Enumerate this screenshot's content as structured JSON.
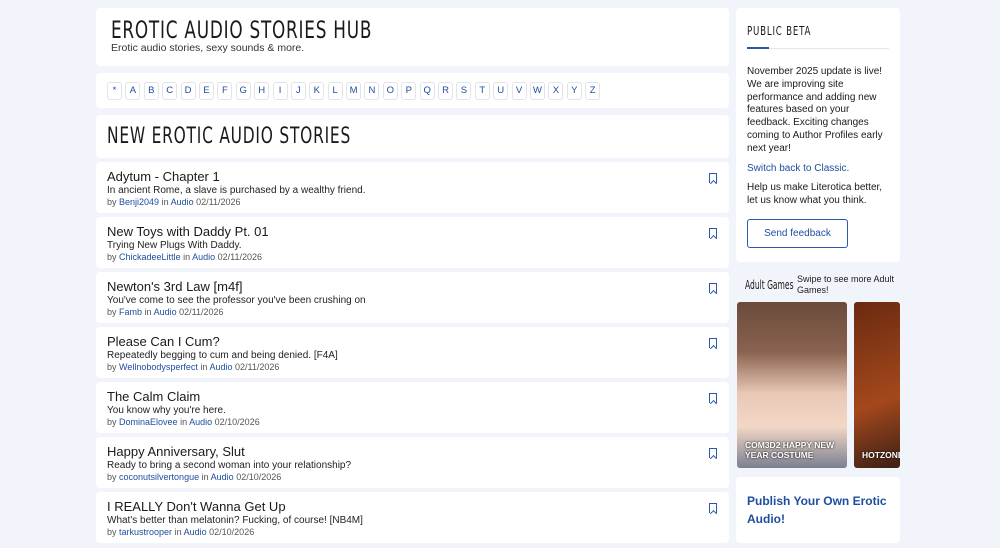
{
  "header": {
    "title": "EROTIC AUDIO STORIES HUB",
    "subtitle": "Erotic audio stories, sexy sounds & more."
  },
  "alphabet": [
    "*",
    "A",
    "B",
    "C",
    "D",
    "E",
    "F",
    "G",
    "H",
    "I",
    "J",
    "K",
    "L",
    "M",
    "N",
    "O",
    "P",
    "Q",
    "R",
    "S",
    "T",
    "U",
    "V",
    "W",
    "X",
    "Y",
    "Z"
  ],
  "section_title": "NEW EROTIC AUDIO STORIES",
  "stories": [
    {
      "title": "Adytum - Chapter 1",
      "desc": "In ancient Rome, a slave is purchased by a wealthy friend.",
      "author": "Benji2049",
      "category": "Audio",
      "date": "02/11/2026"
    },
    {
      "title": "New Toys with Daddy Pt. 01",
      "desc": "Trying New Plugs With Daddy.",
      "author": "ChickadeeLittle",
      "category": "Audio",
      "date": "02/11/2026"
    },
    {
      "title": "Newton's 3rd Law [m4f]",
      "desc": "You've come to see the professor you've been crushing on",
      "author": "Famb",
      "category": "Audio",
      "date": "02/11/2026"
    },
    {
      "title": "Please Can I Cum?",
      "desc": "Repeatedly begging to cum and being denied. [F4A]",
      "author": "Wellnobodysperfect",
      "category": "Audio",
      "date": "02/11/2026"
    },
    {
      "title": "The Calm Claim",
      "desc": "You know why you're here.",
      "author": "DominaElovee",
      "category": "Audio",
      "date": "02/10/2026"
    },
    {
      "title": "Happy Anniversary, Slut",
      "desc": "Ready to bring a second woman into your relationship?",
      "author": "coconutsilvertongue",
      "category": "Audio",
      "date": "02/10/2026"
    },
    {
      "title": "I REALLY Don't Wanna Get Up",
      "desc": "What's better than melatonin? Fucking, of course! [NB4M]",
      "author": "tarkustrooper",
      "category": "Audio",
      "date": "02/10/2026"
    }
  ],
  "labels": {
    "by": "by",
    "in": "in"
  },
  "sidebar": {
    "title": "PUBLIC BETA",
    "text": "November 2025 update is live! We are improving site performance and adding new features based on your feedback. Exciting changes coming to Author Profiles early next year!",
    "switch_link": "Switch back to Classic.",
    "help_text": "Help us make Literotica better, let us know what you think.",
    "feedback_button": "Send feedback"
  },
  "games": {
    "title": "Adult Games",
    "swipe": "Swipe to see more Adult Games!",
    "items": [
      "COM3D2 HAPPY NEW YEAR COSTUME",
      "HOTZONE"
    ]
  },
  "publish_link": "Publish Your Own Erotic Audio!",
  "colors": {
    "accent": "#1f4ea0",
    "background": "#f1f4fa"
  }
}
